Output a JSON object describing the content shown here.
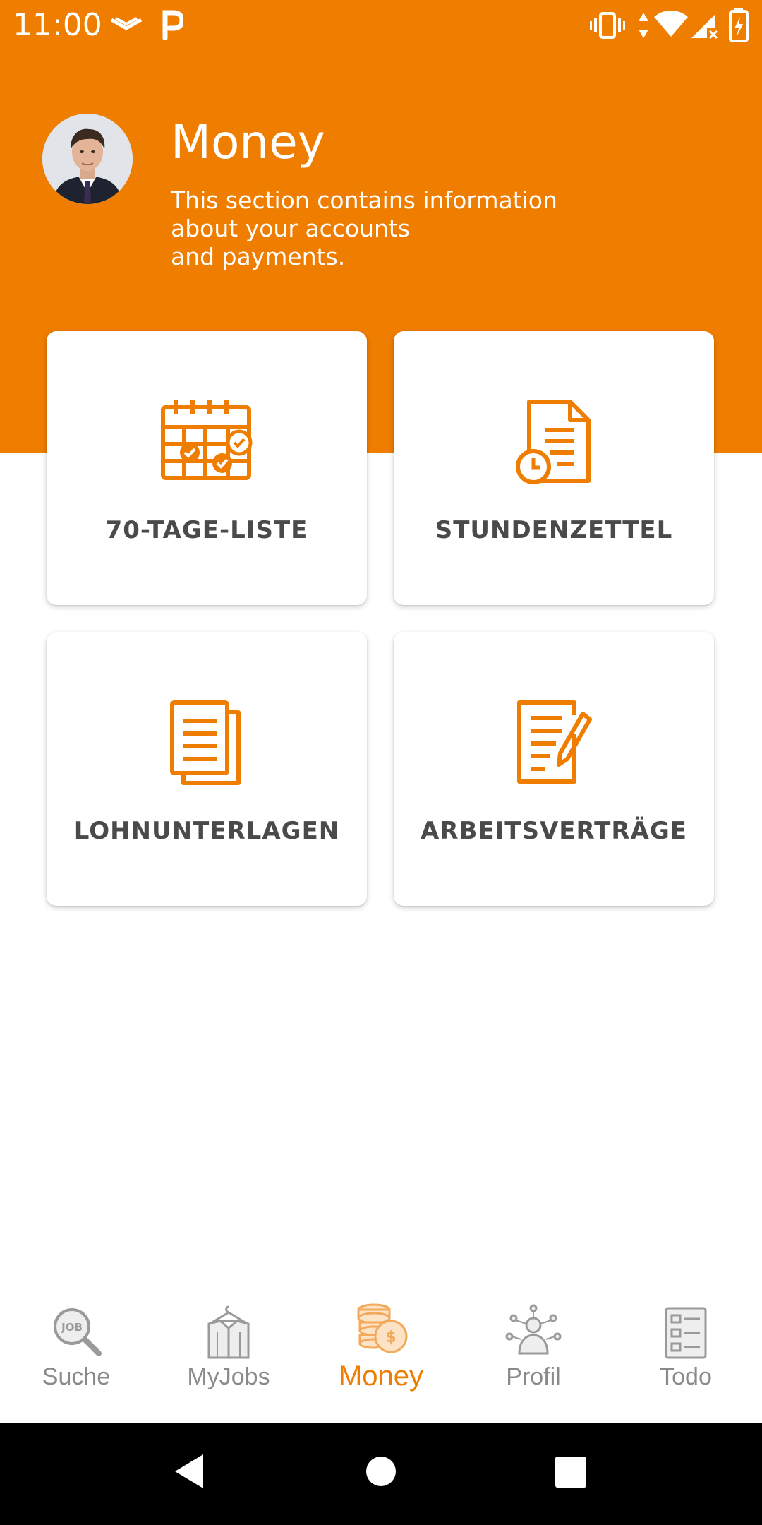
{
  "status_bar": {
    "time": "11:00"
  },
  "header": {
    "title": "Money",
    "subtitle_lines": [
      "This section contains information",
      "about your accounts",
      "and payments."
    ]
  },
  "colors": {
    "accent": "#EF7D00",
    "card_label": "#4a4a4a",
    "nav_inactive": "#8a8a8a",
    "background": "#ffffff"
  },
  "cards": [
    {
      "label": "70-TAGE-LISTE",
      "icon": "calendar-check-icon"
    },
    {
      "label": "STUNDENZETTEL",
      "icon": "document-clock-icon"
    },
    {
      "label": "LOHNUNTERLAGEN",
      "icon": "documents-stack-icon"
    },
    {
      "label": "ARBEITSVERTRÄGE",
      "icon": "contract-pen-icon"
    }
  ],
  "bottom_nav": {
    "items": [
      {
        "label": "Suche",
        "icon": "job-search-icon",
        "active": false
      },
      {
        "label": "MyJobs",
        "icon": "shirt-hanger-icon",
        "active": false
      },
      {
        "label": "Money",
        "icon": "coins-icon",
        "active": true
      },
      {
        "label": "Profil",
        "icon": "profile-network-icon",
        "active": false
      },
      {
        "label": "Todo",
        "icon": "checklist-icon",
        "active": false
      }
    ]
  }
}
